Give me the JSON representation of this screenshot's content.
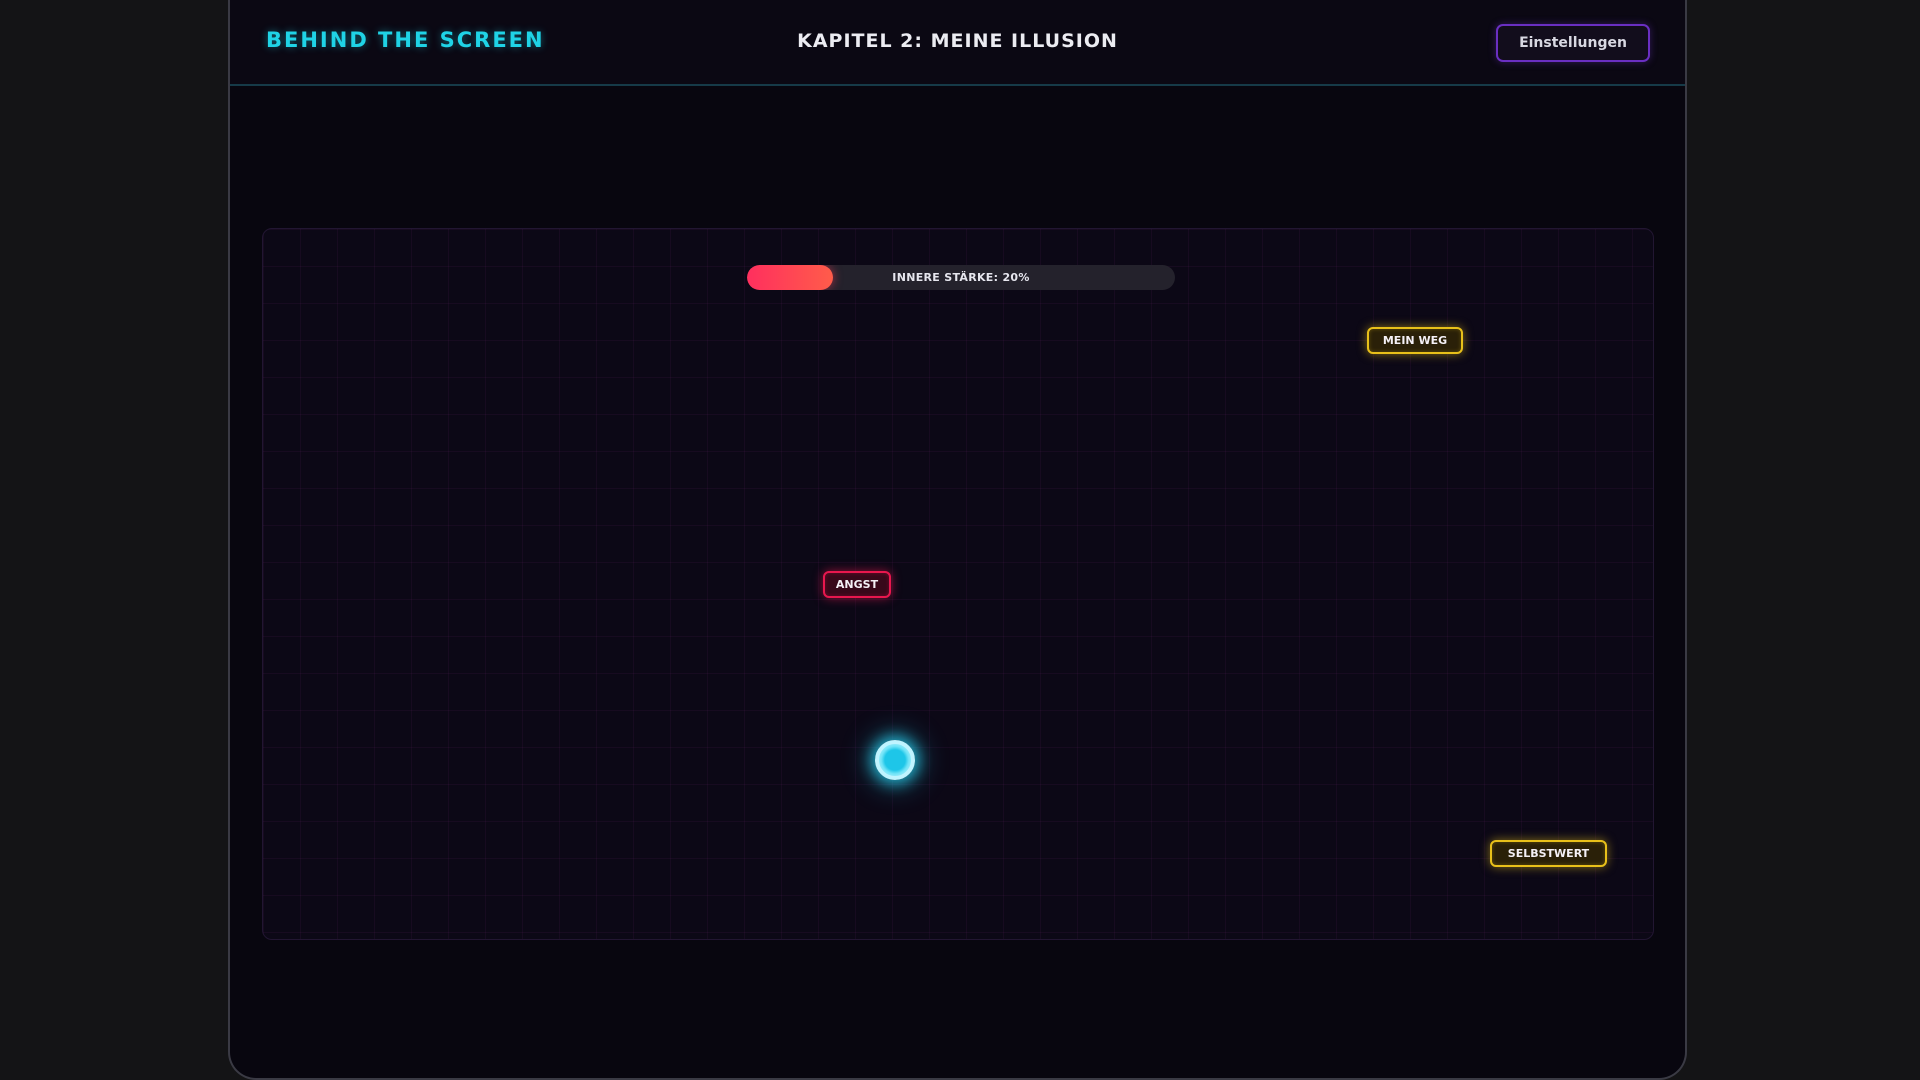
{
  "header": {
    "brand": "BEHIND THE SCREEN",
    "chapter_title": "KAPITEL 2: MEINE ILLUSION",
    "settings_label": "Einstellungen"
  },
  "hud": {
    "strength_label": "INNERE STÄRKE: 20%",
    "strength_value": 0.2,
    "strength_color": "#ff2f5e"
  },
  "tokens": {
    "mein_weg": "MEIN WEG",
    "angst": "ANGST",
    "selbstwert": "SELBSTWERT"
  },
  "colors": {
    "accent_cyan": "#1fd3e6",
    "token_positive": "#e8c01a",
    "token_negative": "#e8174e",
    "settings_border": "#6a2fc2"
  }
}
